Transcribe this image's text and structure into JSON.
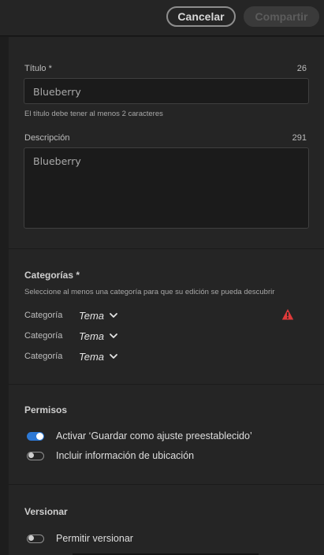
{
  "toolbar": {
    "cancel_label": "Cancelar",
    "share_label": "Compartir"
  },
  "title_field": {
    "label": "Título *",
    "remaining": "26",
    "value": "Blueberry",
    "hint": "El título debe tener al menos 2 caracteres"
  },
  "description_field": {
    "label": "Descripción",
    "remaining": "291",
    "value": "Blueberry"
  },
  "categories": {
    "heading": "Categorías *",
    "hint": "Seleccione al menos una categoría para que su edición se pueda descubrir",
    "rows": [
      {
        "label": "Categoría",
        "value": "Tema",
        "warning": true
      },
      {
        "label": "Categoría",
        "value": "Tema",
        "warning": false
      },
      {
        "label": "Categoría",
        "value": "Tema",
        "warning": false
      }
    ]
  },
  "permissions": {
    "heading": "Permisos",
    "options": [
      {
        "label": "Activar ‘Guardar como ajuste preestablecido’",
        "enabled": true
      },
      {
        "label": "Incluir información de ubicación",
        "enabled": false
      }
    ]
  },
  "versioning": {
    "heading": "Versionar",
    "options": [
      {
        "label": "Permitir versionar",
        "enabled": false
      }
    ]
  },
  "colors": {
    "accent": "#2d79d6",
    "warning": "#e03a3a",
    "panel": "#252525",
    "background": "#1d1d1d"
  },
  "icons": {
    "dropdown": "chevron-down-icon",
    "warning": "warning-triangle-icon"
  }
}
